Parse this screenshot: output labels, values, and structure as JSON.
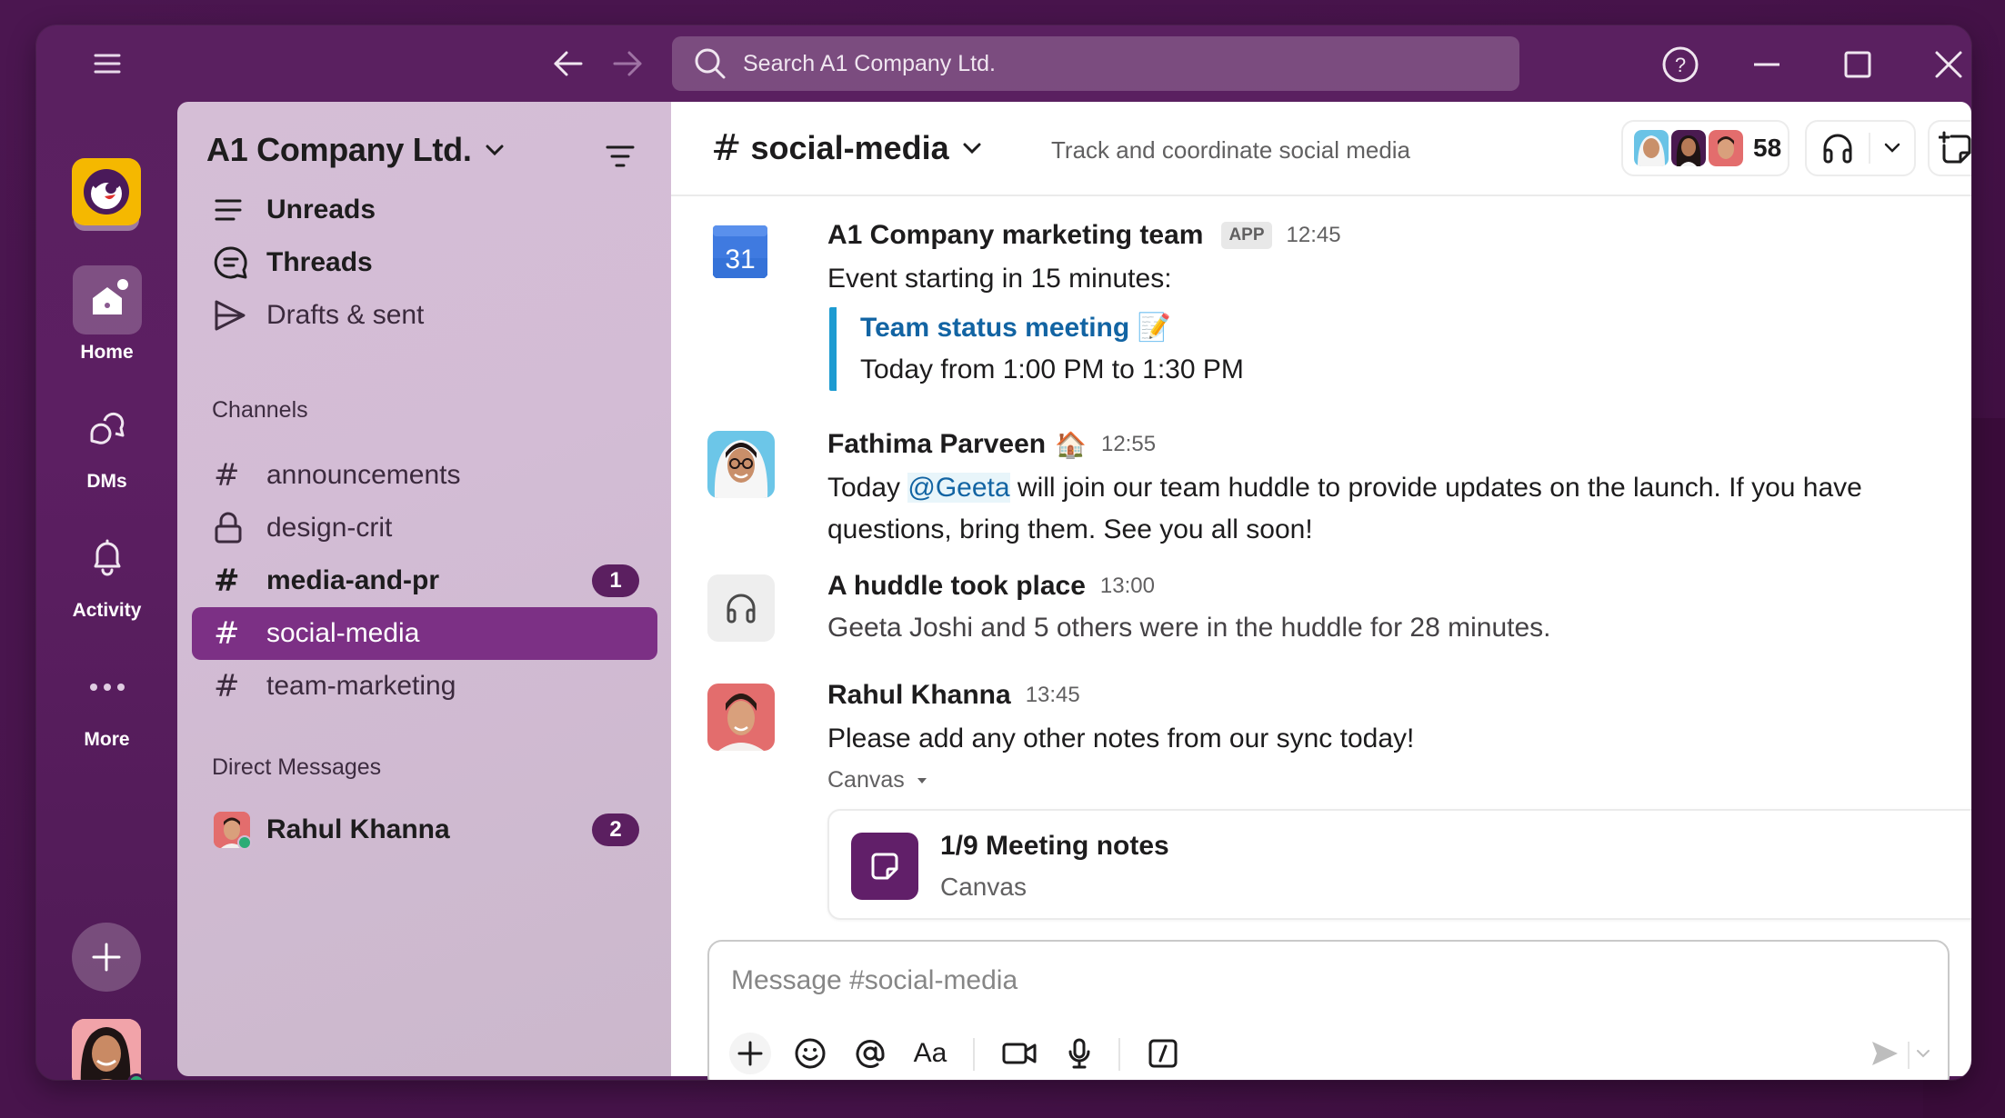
{
  "app": {
    "window_controls": {
      "help_label": "Help",
      "minimize_label": "Minimize",
      "maximize_label": "Maximize",
      "close_label": "Close"
    },
    "search": {
      "placeholder": "Search A1 Company Ltd."
    }
  },
  "rail": {
    "items": [
      {
        "label": "Home",
        "icon": "home-icon",
        "active": true
      },
      {
        "label": "DMs",
        "icon": "dms-icon"
      },
      {
        "label": "Activity",
        "icon": "bell-icon"
      },
      {
        "label": "More",
        "icon": "more-icon"
      }
    ],
    "add_label": "+"
  },
  "sidebar": {
    "workspace_name": "A1 Company Ltd.",
    "nav": [
      {
        "label": "Unreads",
        "icon": "unreads-icon",
        "bold": true
      },
      {
        "label": "Threads",
        "icon": "threads-icon",
        "bold": true
      },
      {
        "label": "Drafts & sent",
        "icon": "send-icon",
        "bold": false
      }
    ],
    "channels_label": "Channels",
    "channels": [
      {
        "name": "announcements",
        "type": "public"
      },
      {
        "name": "design-crit",
        "type": "private"
      },
      {
        "name": "media-and-pr",
        "type": "public",
        "unread": true,
        "badge": "1"
      },
      {
        "name": "social-media",
        "type": "public",
        "selected": true
      },
      {
        "name": "team-marketing",
        "type": "public"
      }
    ],
    "dms_label": "Direct Messages",
    "dms": [
      {
        "name": "Rahul Khanna",
        "badge": "2",
        "online": true
      }
    ]
  },
  "channel": {
    "hash": "#",
    "name": "social-media",
    "topic": "Track and coordinate social media",
    "member_count": "58"
  },
  "messages": [
    {
      "author": "A1 Company marketing team",
      "tag": "APP",
      "time": "12:45",
      "avatar_icon": "calendar-icon",
      "calendar_day": "31",
      "text": "Event starting in 15 minutes:",
      "quote": {
        "link": "Team status meeting",
        "emoji": "📝",
        "detail": "Today from 1:00 PM to 1:30 PM"
      }
    },
    {
      "author": "Fathima Parveen",
      "status_emoji": "🏠",
      "time": "12:55",
      "text_before": "Today ",
      "mention": "@Geeta",
      "text_after": " will join our team huddle to provide updates on the launch. If you have questions, bring them. See you all soon!"
    },
    {
      "author": "A huddle took place",
      "time": "13:00",
      "avatar_icon": "headphones-icon",
      "text": "Geeta Joshi and 5 others were in the huddle for 28 minutes."
    },
    {
      "author": "Rahul Khanna",
      "time": "13:45",
      "text": "Please add any other notes from our sync today!",
      "attachment_label": "Canvas",
      "attachment": {
        "title": "1/9 Meeting notes",
        "subtitle": "Canvas"
      }
    }
  ],
  "composer": {
    "placeholder": "Message #social-media",
    "format_label": "Aa"
  },
  "colors": {
    "brand_purple": "#611f69",
    "selected_channel": "#7c3085",
    "badge": "#5b1f60",
    "link": "#1264a3",
    "quote_bar": "#1d9bd1",
    "presence": "#2bac76",
    "workspace_tile": "#f5b800"
  }
}
